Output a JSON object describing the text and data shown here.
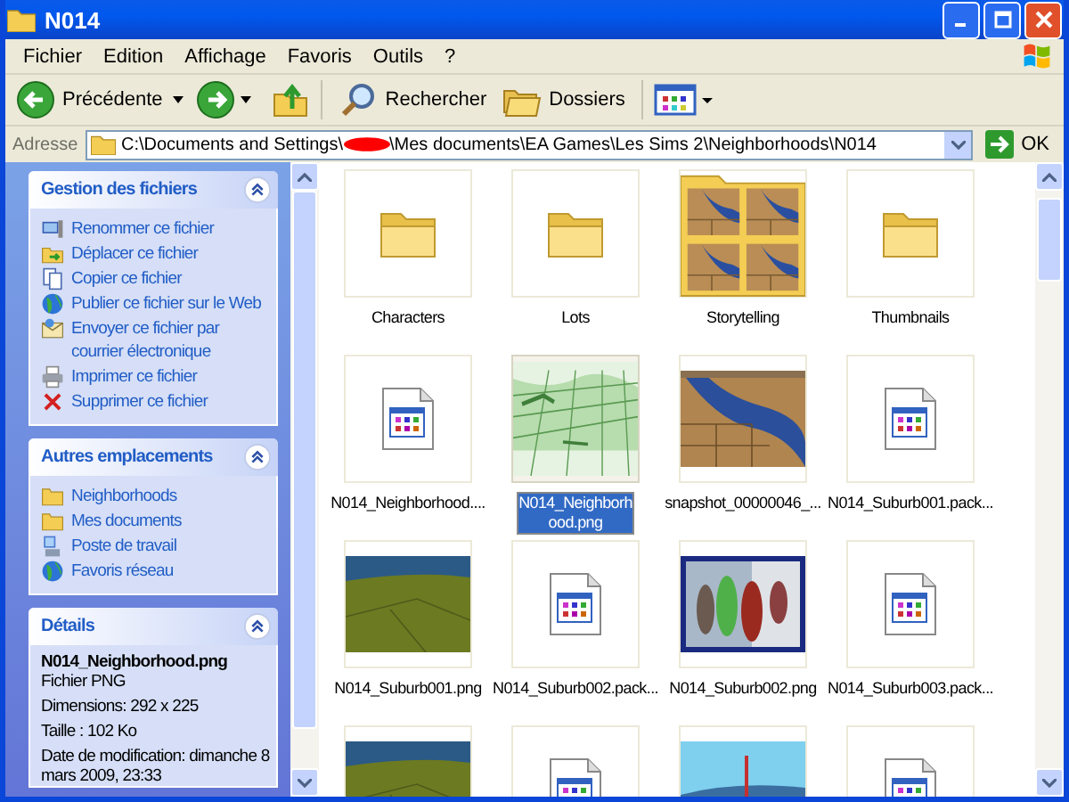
{
  "window": {
    "title": "N014"
  },
  "menu": [
    "Fichier",
    "Edition",
    "Affichage",
    "Favoris",
    "Outils",
    "?"
  ],
  "toolbar": {
    "back": "Précédente",
    "search": "Rechercher",
    "folders": "Dossiers"
  },
  "address": {
    "label": "Adresse",
    "path_start": "C:\\Documents and Settings\\",
    "path_end": "\\Mes documents\\EA Games\\Les Sims 2\\Neighborhoods\\N014",
    "go": "OK"
  },
  "tasks": {
    "title": "Gestion des fichiers",
    "expanded": true,
    "items": [
      {
        "label": "Renommer ce fichier"
      },
      {
        "label": "Déplacer ce fichier"
      },
      {
        "label": "Copier ce fichier"
      },
      {
        "label": "Publier ce fichier sur le Web"
      },
      {
        "label": "Envoyer ce fichier par courrier électronique"
      },
      {
        "label": "Imprimer ce fichier"
      },
      {
        "label": "Supprimer ce fichier"
      }
    ]
  },
  "places": {
    "title": "Autres emplacements",
    "expanded": true,
    "items": [
      {
        "label": "Neighborhoods"
      },
      {
        "label": "Mes documents"
      },
      {
        "label": "Poste de travail"
      },
      {
        "label": "Favoris réseau"
      }
    ]
  },
  "details": {
    "title": "Détails",
    "expanded": true,
    "name": "N014_Neighborhood.png",
    "lines": [
      "Fichier PNG",
      "Dimensions: 292 x 225",
      "Taille : 102 Ko",
      "Date de modification: dimanche 8 mars 2009, 23:33"
    ]
  },
  "files": [
    {
      "label": "Characters",
      "kind": "folder",
      "selected": false
    },
    {
      "label": "Lots",
      "kind": "folder",
      "selected": false
    },
    {
      "label": "Storytelling",
      "kind": "folder-thumbs",
      "selected": false
    },
    {
      "label": "Thumbnails",
      "kind": "folder",
      "selected": false
    },
    {
      "label": "N014_Neighborhood....",
      "kind": "file",
      "selected": false
    },
    {
      "label": "N014_Neighborhood.png",
      "kind": "picture",
      "selected": true
    },
    {
      "label": "snapshot_00000046_...",
      "kind": "picture",
      "selected": false
    },
    {
      "label": "N014_Suburb001.pack...",
      "kind": "file",
      "selected": false
    },
    {
      "label": "N014_Suburb001.png",
      "kind": "picture",
      "selected": false
    },
    {
      "label": "N014_Suburb002.pack...",
      "kind": "file",
      "selected": false
    },
    {
      "label": "N014_Suburb002.png",
      "kind": "picture",
      "selected": false
    },
    {
      "label": "N014_Suburb003.pack...",
      "kind": "file",
      "selected": false
    },
    {
      "kind": "picture",
      "selected": false
    },
    {
      "kind": "file",
      "selected": false
    },
    {
      "kind": "picture",
      "selected": false
    },
    {
      "kind": "file",
      "selected": false
    }
  ]
}
